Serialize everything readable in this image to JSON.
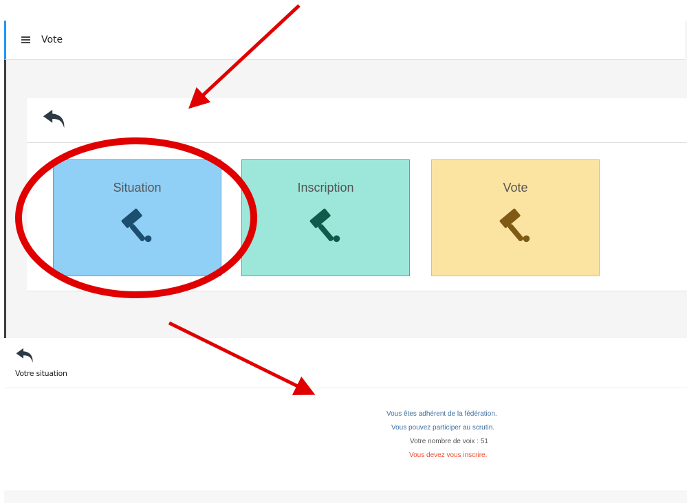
{
  "app": {
    "title": "Vote"
  },
  "panel": {
    "tiles": [
      {
        "label": "Situation",
        "icon": "gavel-icon",
        "bg": "#90d0f6",
        "border": "#45a9e3",
        "icon_color": "#1c4e70"
      },
      {
        "label": "Inscription",
        "icon": "gavel-icon",
        "bg": "#9de7da",
        "border": "#35b79d",
        "icon_color": "#0f5a4a"
      },
      {
        "label": "Vote",
        "icon": "gavel-icon",
        "bg": "#fbe3a1",
        "border": "#f0c040",
        "icon_color": "#7e5a14"
      }
    ]
  },
  "situation": {
    "header_label": "Votre situation",
    "lines": [
      "Vous êtes adhérent de la fédération.",
      "Vous pouvez participer au scrutin.",
      "Votre nombre de voix : 51",
      "Vous devez vous inscrire."
    ],
    "line_colors": [
      "#3f6fa0",
      "#3f6fa0",
      "#555555",
      "#f04b32"
    ]
  },
  "annotations": {
    "color": "#e00000"
  }
}
